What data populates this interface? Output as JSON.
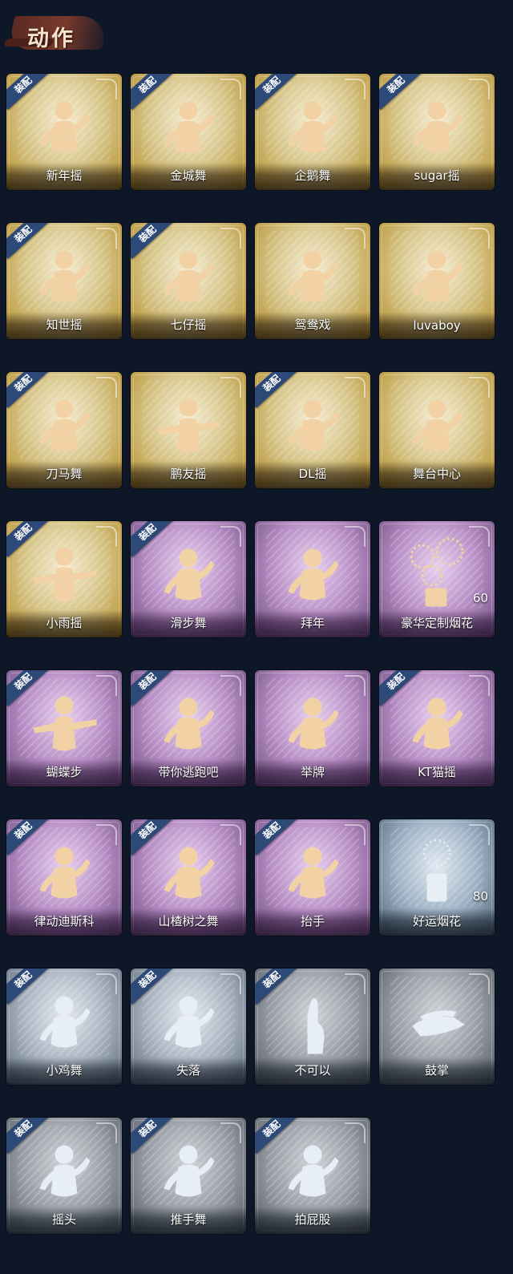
{
  "header": {
    "title": "动作"
  },
  "equip_badge": "装配",
  "cards": [
    {
      "label": "新年摇",
      "tier": "gold",
      "equipped": true,
      "count": ""
    },
    {
      "label": "金城舞",
      "tier": "gold",
      "equipped": true,
      "count": ""
    },
    {
      "label": "企鹅舞",
      "tier": "gold",
      "equipped": true,
      "count": ""
    },
    {
      "label": "sugar摇",
      "tier": "gold",
      "equipped": true,
      "count": ""
    },
    {
      "label": "知世摇",
      "tier": "gold",
      "equipped": true,
      "count": ""
    },
    {
      "label": "七仔摇",
      "tier": "gold",
      "equipped": true,
      "count": ""
    },
    {
      "label": "鸳鸯戏",
      "tier": "gold",
      "equipped": false,
      "count": ""
    },
    {
      "label": "luvaboy",
      "tier": "gold",
      "equipped": false,
      "count": ""
    },
    {
      "label": "刀马舞",
      "tier": "gold",
      "equipped": true,
      "count": ""
    },
    {
      "label": "鹏友摇",
      "tier": "gold",
      "equipped": false,
      "count": ""
    },
    {
      "label": "DL摇",
      "tier": "gold",
      "equipped": true,
      "count": ""
    },
    {
      "label": "舞台中心",
      "tier": "gold",
      "equipped": false,
      "count": ""
    },
    {
      "label": "小雨摇",
      "tier": "gold",
      "equipped": true,
      "count": ""
    },
    {
      "label": "滑步舞",
      "tier": "purple",
      "equipped": true,
      "count": ""
    },
    {
      "label": "拜年",
      "tier": "purple",
      "equipped": false,
      "count": ""
    },
    {
      "label": "豪华定制烟花",
      "tier": "purple",
      "equipped": false,
      "count": "60"
    },
    {
      "label": "蝴蝶步",
      "tier": "purple",
      "equipped": true,
      "count": ""
    },
    {
      "label": "带你逃跑吧",
      "tier": "purple",
      "equipped": true,
      "count": ""
    },
    {
      "label": "举牌",
      "tier": "purple",
      "equipped": false,
      "count": ""
    },
    {
      "label": "KT猫摇",
      "tier": "purple",
      "equipped": true,
      "count": ""
    },
    {
      "label": "律动迪斯科",
      "tier": "purple",
      "equipped": true,
      "count": ""
    },
    {
      "label": "山楂树之舞",
      "tier": "purple",
      "equipped": true,
      "count": ""
    },
    {
      "label": "抬手",
      "tier": "purple",
      "equipped": true,
      "count": ""
    },
    {
      "label": "好运烟花",
      "tier": "blue",
      "equipped": false,
      "count": "80"
    },
    {
      "label": "小鸡舞",
      "tier": "silver",
      "equipped": true,
      "count": ""
    },
    {
      "label": "失落",
      "tier": "silver",
      "equipped": true,
      "count": ""
    },
    {
      "label": "不可以",
      "tier": "gray",
      "equipped": true,
      "count": ""
    },
    {
      "label": "鼓掌",
      "tier": "gray",
      "equipped": false,
      "count": ""
    },
    {
      "label": "摇头",
      "tier": "gray",
      "equipped": true,
      "count": ""
    },
    {
      "label": "推手舞",
      "tier": "gray",
      "equipped": true,
      "count": ""
    },
    {
      "label": "拍屁股",
      "tier": "gray",
      "equipped": true,
      "count": ""
    }
  ]
}
